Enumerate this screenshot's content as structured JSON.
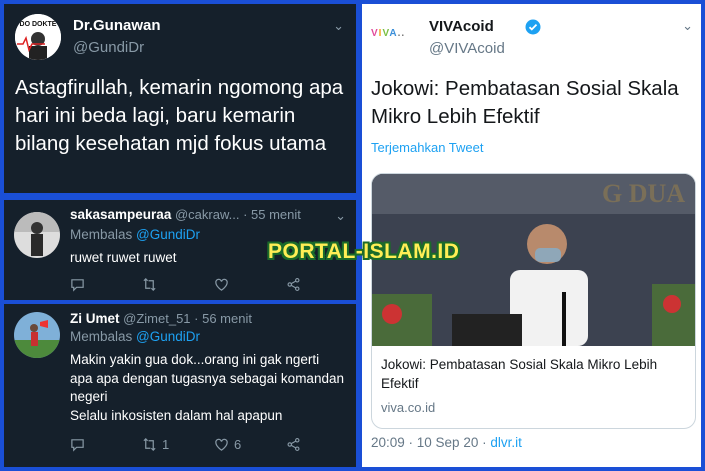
{
  "main_tweet": {
    "name": "Dr.Gunawan",
    "handle": "@GundiDr",
    "avatar_text": "DO DOKTE",
    "text": "Astagfirullah, kemarin ngomong apa hari ini beda lagi, baru kemarin bilang kesehatan mjd fokus utama"
  },
  "replies": [
    {
      "name": "sakasampeuraa",
      "handle": "@cakraw...",
      "time": "· 55 menit",
      "replying_prefix": "Membalas",
      "replying_to": "@GundiDr",
      "text": "ruwet ruwet ruwet",
      "retweets": "",
      "likes": ""
    },
    {
      "name": "Zi Umet",
      "handle": "@Zimet_51",
      "time": "· 56 menit",
      "replying_prefix": "Membalas",
      "replying_to": "@GundiDr",
      "text": "Makin yakin gua dok...orang ini gak ngerti apa apa dengan tugasnya sebagai komandan negeri\nSelalu inkosisten dalam hal apapun",
      "retweets": "1",
      "likes": "6"
    }
  ],
  "viva_tweet": {
    "logo_text": "VIVA",
    "name": "VIVAcoid",
    "handle": "@VIVAcoid",
    "text": "Jokowi: Pembatasan Sosial Skala Mikro Lebih Efektif",
    "translate": "Terjemahkan Tweet",
    "card_title": "Jokowi: Pembatasan Sosial Skala Mikro Lebih Efektif",
    "card_domain": "viva.co.id",
    "time": "20:09 · 10 Sep 20 · ",
    "source": "dlvr.it"
  },
  "watermark": "PORTAL-ISLAM.ID",
  "colors": {
    "dark_bg": "#15202b",
    "link": "#1da1f2",
    "border": "#1a4fd6",
    "watermark": "#ffee55"
  }
}
